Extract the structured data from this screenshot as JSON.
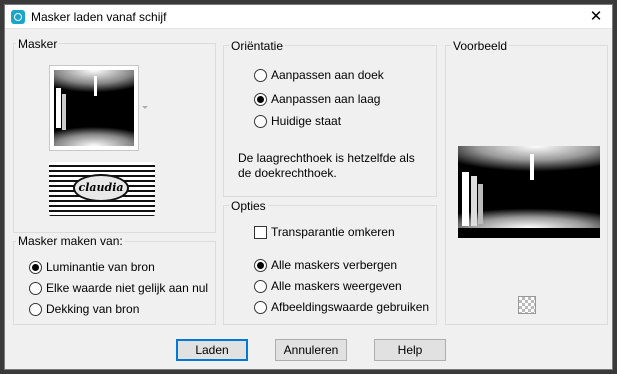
{
  "window": {
    "title": "Masker laden vanaf schijf",
    "close_glyph": "✕"
  },
  "masker": {
    "label": "Masker",
    "watermark_text": "claudia"
  },
  "source": {
    "label": "Masker maken van:",
    "options": [
      {
        "label": "Luminantie van bron",
        "selected": true
      },
      {
        "label": "Elke waarde niet gelijk aan nul",
        "selected": false
      },
      {
        "label": "Dekking van bron",
        "selected": false
      }
    ]
  },
  "orientation": {
    "label": "Oriëntatie",
    "options": [
      {
        "label": "Aanpassen aan doek",
        "selected": false
      },
      {
        "label": "Aanpassen aan laag",
        "selected": true
      },
      {
        "label": "Huidige staat",
        "selected": false
      }
    ],
    "info_line1": "De laagrechthoek is hetzelfde als",
    "info_line2": "de doekrechthoek."
  },
  "options": {
    "label": "Opties",
    "invert_label": "Transparantie omkeren",
    "invert_checked": false,
    "radios": [
      {
        "label": "Alle maskers verbergen",
        "selected": true
      },
      {
        "label": "Alle maskers weergeven",
        "selected": false
      },
      {
        "label": "Afbeeldingswaarde gebruiken",
        "selected": false
      }
    ]
  },
  "preview": {
    "label": "Voorbeeld"
  },
  "buttons": {
    "load": "Laden",
    "cancel": "Annuleren",
    "help": "Help"
  },
  "colors": {
    "accent": "#0078d7",
    "icon": "#1aa6c9"
  }
}
